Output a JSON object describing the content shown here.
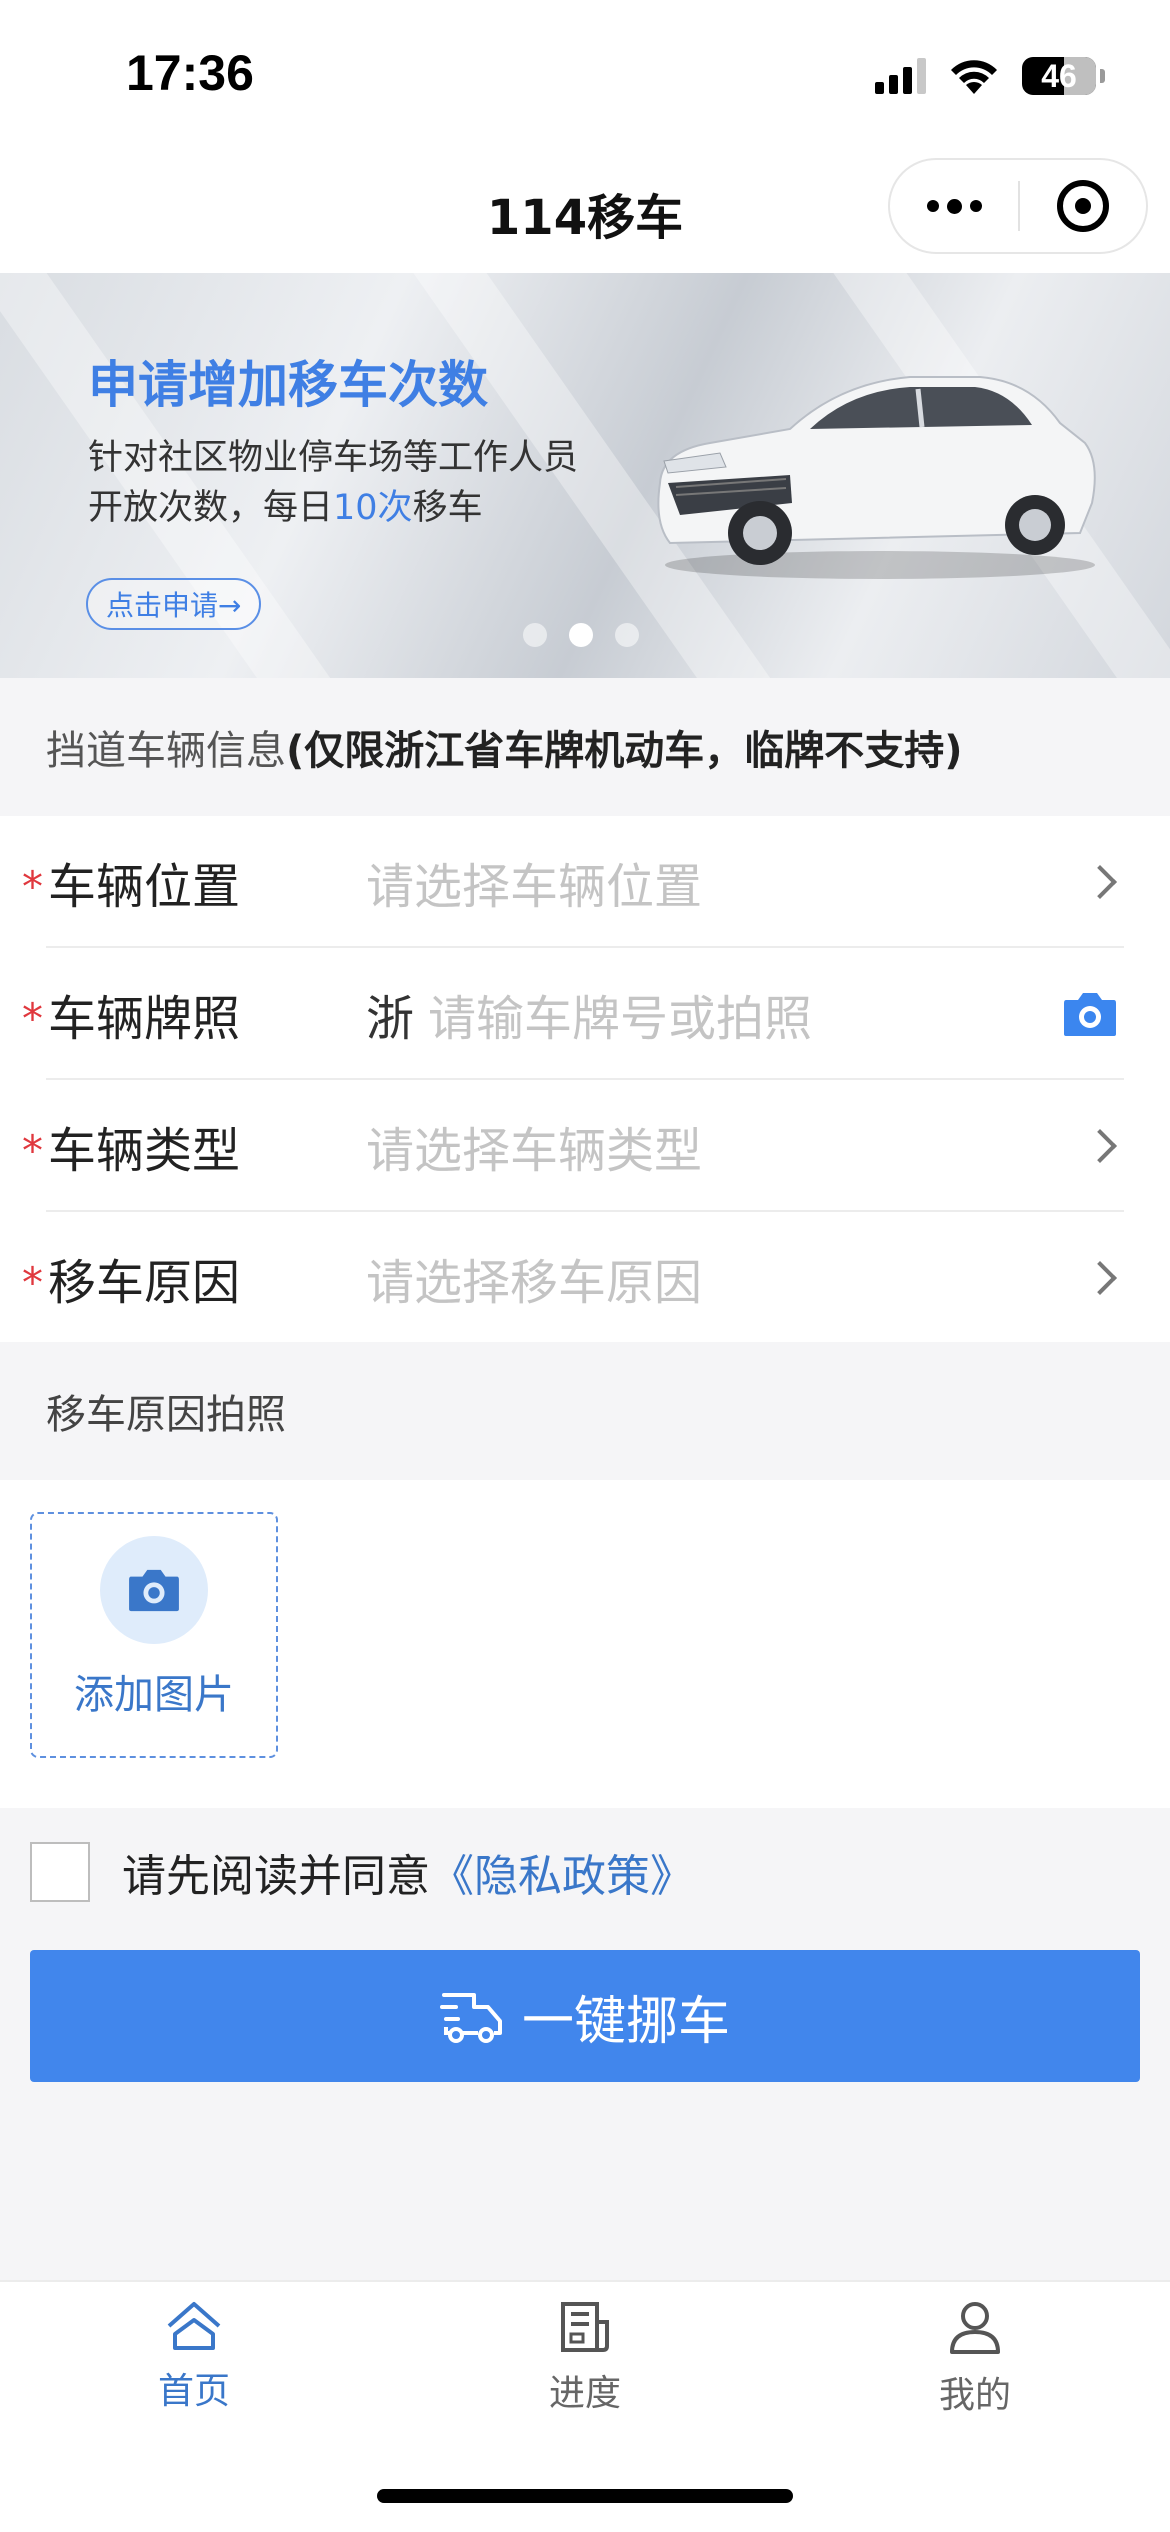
{
  "status_bar": {
    "time": "17:36",
    "battery": "46"
  },
  "nav": {
    "title": "114移车"
  },
  "banner": {
    "title": "申请增加移车次数",
    "desc_line1": "针对社区物业停车场等工作人员",
    "desc_line2_prefix": "开放次数，每日",
    "desc_highlight": "10次",
    "desc_line2_suffix": "移车",
    "button": "点击申请→",
    "active_slide_index": 1,
    "slide_count": 3
  },
  "section": {
    "title_light": "挡道车辆信息",
    "title_strong": "(仅限浙江省车牌机动车，临牌不支持)"
  },
  "form": {
    "rows": [
      {
        "label": "车辆位置",
        "placeholder": "请选择车辆位置"
      },
      {
        "label": "车辆牌照",
        "prefix": "浙",
        "placeholder": "请输车牌号或拍照"
      },
      {
        "label": "车辆类型",
        "placeholder": "请选择车辆类型"
      },
      {
        "label": "移车原因",
        "placeholder": "请选择移车原因"
      }
    ],
    "required_mark": "*"
  },
  "photo": {
    "title": "移车原因拍照",
    "add_label": "添加图片"
  },
  "agreement": {
    "text": "请先阅读并同意",
    "link": "《隐私政策》",
    "checked": false
  },
  "main_button": {
    "label": "一键挪车"
  },
  "tabs": [
    {
      "label": "首页",
      "icon": "home-icon",
      "active": true
    },
    {
      "label": "进度",
      "icon": "progress-icon",
      "active": false
    },
    {
      "label": "我的",
      "icon": "profile-icon",
      "active": false
    }
  ],
  "colors": {
    "accent": "#4186ec",
    "link": "#3a77c9",
    "required": "#e0383e",
    "banner_title": "#3f7fe4"
  }
}
